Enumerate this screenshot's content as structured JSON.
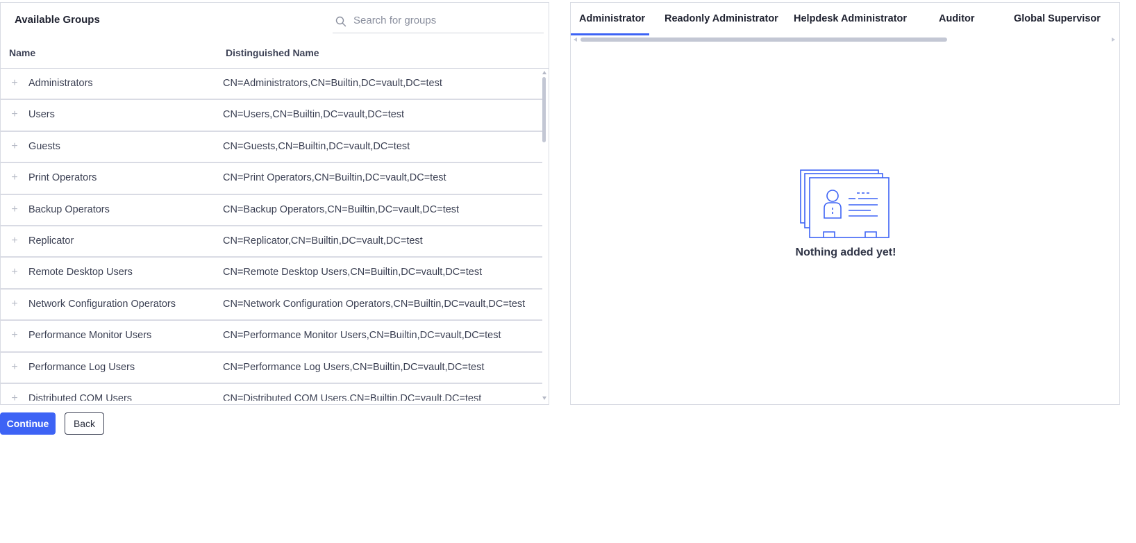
{
  "left_panel": {
    "title": "Available Groups",
    "search": {
      "placeholder": "Search for groups",
      "value": ""
    },
    "columns": {
      "name": "Name",
      "dn": "Distinguished Name"
    },
    "rows": [
      {
        "name": "Administrators",
        "dn": "CN=Administrators,CN=Builtin,DC=vault,DC=test"
      },
      {
        "name": "Users",
        "dn": "CN=Users,CN=Builtin,DC=vault,DC=test"
      },
      {
        "name": "Guests",
        "dn": "CN=Guests,CN=Builtin,DC=vault,DC=test"
      },
      {
        "name": "Print Operators",
        "dn": "CN=Print Operators,CN=Builtin,DC=vault,DC=test"
      },
      {
        "name": "Backup Operators",
        "dn": "CN=Backup Operators,CN=Builtin,DC=vault,DC=test"
      },
      {
        "name": "Replicator",
        "dn": "CN=Replicator,CN=Builtin,DC=vault,DC=test"
      },
      {
        "name": "Remote Desktop Users",
        "dn": "CN=Remote Desktop Users,CN=Builtin,DC=vault,DC=test"
      },
      {
        "name": "Network Configuration Operators",
        "dn": "CN=Network Configuration Operators,CN=Builtin,DC=vault,DC=test"
      },
      {
        "name": "Performance Monitor Users",
        "dn": "CN=Performance Monitor Users,CN=Builtin,DC=vault,DC=test"
      },
      {
        "name": "Performance Log Users",
        "dn": "CN=Performance Log Users,CN=Builtin,DC=vault,DC=test"
      },
      {
        "name": "Distributed COM Users",
        "dn": "CN=Distributed COM Users,CN=Builtin,DC=vault,DC=test"
      }
    ]
  },
  "buttons": {
    "continue": "Continue",
    "back": "Back"
  },
  "right_panel": {
    "tabs": [
      {
        "label": "Administrator",
        "active": true
      },
      {
        "label": "Readonly Administrator",
        "active": false
      },
      {
        "label": "Helpdesk Administrator",
        "active": false
      },
      {
        "label": "Auditor",
        "active": false
      },
      {
        "label": "Global Supervisor",
        "active": false
      }
    ],
    "empty_state": "Nothing added yet!"
  },
  "colors": {
    "accent": "#3d63f5",
    "illustration": "#3d63f5",
    "border": "#d8dbe3"
  },
  "icons": {
    "search": "search-icon",
    "row_add": "plus-icon",
    "empty": "id-cards-illustration"
  }
}
